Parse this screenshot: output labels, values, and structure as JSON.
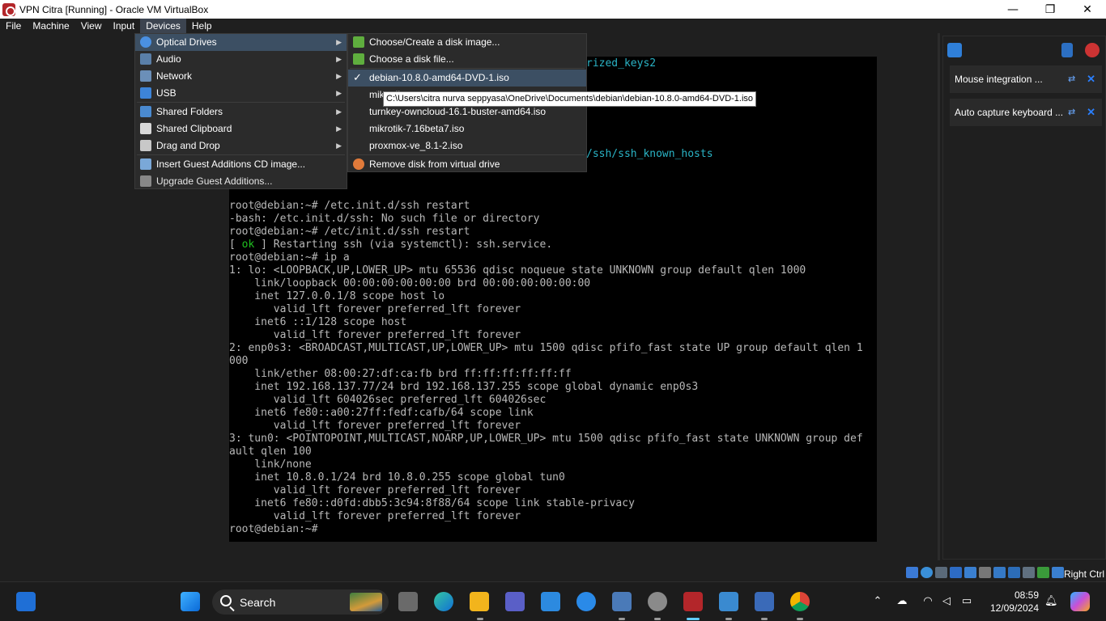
{
  "window": {
    "title": "VPN Citra [Running] - Oracle VM VirtualBox",
    "minimize": "—",
    "restore": "❐",
    "close": "✕"
  },
  "menubar": [
    "File",
    "Machine",
    "View",
    "Input",
    "Devices",
    "Help"
  ],
  "devices_menu": {
    "items": [
      {
        "label": "Optical Drives",
        "icon": "optical-disc-icon",
        "submenu": true
      },
      {
        "label": "Audio",
        "icon": "audio-icon",
        "submenu": true
      },
      {
        "label": "Network",
        "icon": "network-icon",
        "submenu": true
      },
      {
        "label": "USB",
        "icon": "usb-icon",
        "submenu": true
      },
      {
        "label": "Shared Folders",
        "icon": "shared-folders-icon",
        "submenu": true
      },
      {
        "label": "Shared Clipboard",
        "icon": "clipboard-icon",
        "submenu": true
      },
      {
        "label": "Drag and Drop",
        "icon": "drag-drop-icon",
        "submenu": true
      },
      {
        "label": "Insert Guest Additions CD image...",
        "icon": "guest-additions-icon",
        "submenu": false
      },
      {
        "label": "Upgrade Guest Additions...",
        "icon": "upgrade-icon",
        "submenu": false
      }
    ]
  },
  "optical_menu": {
    "choose_create": "Choose/Create a disk image...",
    "choose_file": "Choose a disk file...",
    "disks": [
      {
        "label": "debian-10.8.0-amd64-DVD-1.iso",
        "checked": true
      },
      {
        "label": "mikrotik",
        "checked": false
      },
      {
        "label": "turnkey-owncloud-16.1-buster-amd64.iso",
        "checked": false
      },
      {
        "label": "mikrotik-7.16beta7.iso",
        "checked": false
      },
      {
        "label": "proxmox-ve_8.1-2.iso",
        "checked": false
      }
    ],
    "remove": "Remove disk from virtual drive"
  },
  "tooltip": "C:\\Users\\citra nurva seppyasa\\OneDrive\\Documents\\debian\\debian-10.8.0-amd64-DVD-1.iso",
  "terminal": {
    "partial_top1": "rized_keys2",
    "partial_top2": "/ssh/ssh_known_hosts",
    "lines": [
      "root@debian:~# /etc.init.d/ssh restart",
      "-bash: /etc.init.d/ssh: No such file or directory",
      "root@debian:~# /etc/init.d/ssh restart",
      "[ ok ] Restarting ssh (via systemctl): ssh.service.",
      "root@debian:~# ip a",
      "1: lo: <LOOPBACK,UP,LOWER_UP> mtu 65536 qdisc noqueue state UNKNOWN group default qlen 1000",
      "    link/loopback 00:00:00:00:00:00 brd 00:00:00:00:00:00",
      "    inet 127.0.0.1/8 scope host lo",
      "       valid_lft forever preferred_lft forever",
      "    inet6 ::1/128 scope host",
      "       valid_lft forever preferred_lft forever",
      "2: enp0s3: <BROADCAST,MULTICAST,UP,LOWER_UP> mtu 1500 qdisc pfifo_fast state UP group default qlen 1",
      "000",
      "    link/ether 08:00:27:df:ca:fb brd ff:ff:ff:ff:ff:ff",
      "    inet 192.168.137.77/24 brd 192.168.137.255 scope global dynamic enp0s3",
      "       valid_lft 604026sec preferred_lft 604026sec",
      "    inet6 fe80::a00:27ff:fedf:cafb/64 scope link",
      "       valid_lft forever preferred_lft forever",
      "3: tun0: <POINTOPOINT,MULTICAST,NOARP,UP,LOWER_UP> mtu 1500 qdisc pfifo_fast state UNKNOWN group def",
      "ault qlen 100",
      "    link/none",
      "    inet 10.8.0.1/24 brd 10.8.0.255 scope global tun0",
      "       valid_lft forever preferred_lft forever",
      "    inet6 fe80::d0fd:dbb5:3c94:8f88/64 scope link stable-privacy",
      "       valid_lft forever preferred_lft forever",
      "root@debian:~#"
    ]
  },
  "sidepanel": {
    "notices": [
      {
        "label": "Mouse integration ..."
      },
      {
        "label": "Auto capture keyboard ..."
      }
    ]
  },
  "statusbar": {
    "host_key": "Right Ctrl"
  },
  "taskbar": {
    "search_placeholder": "Search",
    "time": "08:59",
    "date": "12/09/2024"
  }
}
